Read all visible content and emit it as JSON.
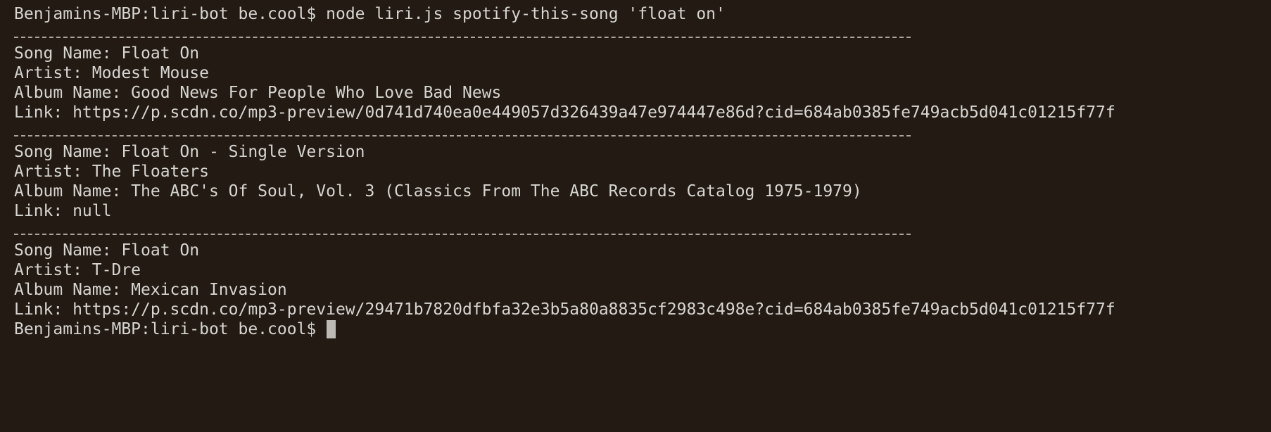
{
  "terminal": {
    "prompt": "Benjamins-MBP:liri-bot be.cool$",
    "command": "node liri.js spotify-this-song 'float on'",
    "results": [
      {
        "song": "Song Name: Float On",
        "artist": "Artist: Modest Mouse",
        "album": "Album Name: Good News For People Who Love Bad News",
        "link": "Link: https://p.scdn.co/mp3-preview/0d741d740ea0e449057d326439a47e974447e86d?cid=684ab0385fe749acb5d041c01215f77f"
      },
      {
        "song": "Song Name: Float On - Single Version",
        "artist": "Artist: The Floaters",
        "album": "Album Name: The ABC's Of Soul, Vol. 3 (Classics From The ABC Records Catalog 1975-1979)",
        "link": "Link: null"
      },
      {
        "song": "Song Name: Float On",
        "artist": "Artist: T-Dre",
        "album": "Album Name: Mexican Invasion",
        "link": "Link: https://p.scdn.co/mp3-preview/29471b7820dfbfa32e3b5a80a8835cf2983c498e?cid=684ab0385fe749acb5d041c01215f77f"
      }
    ],
    "colors": {
      "background": "#221a13",
      "text": "#d7d5d1",
      "cursor": "#bdbab5"
    }
  }
}
